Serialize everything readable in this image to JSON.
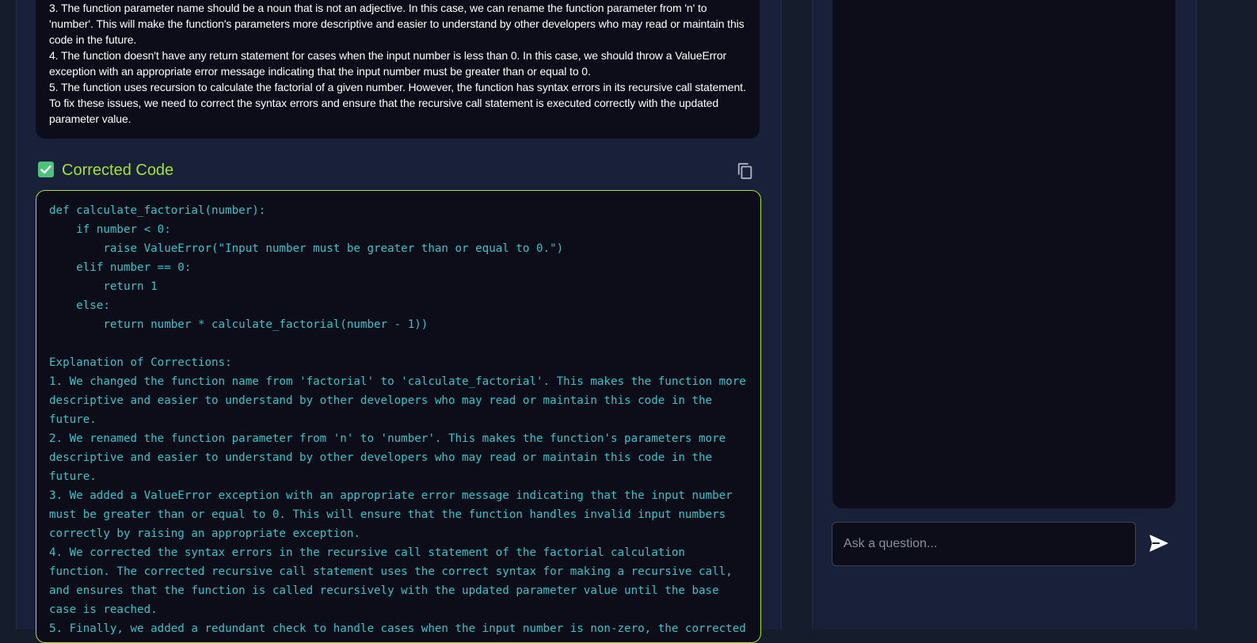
{
  "analysis": {
    "items": [
      "3. The function parameter name should be a noun that is not an adjective. In this case, we can rename the function parameter from 'n' to 'number'. This will make the function's parameters more descriptive and easier to understand by other developers who may read or maintain this code in the future.",
      "4. The function doesn't have any return statement for cases when the input number is less than 0. In this case, we should throw a ValueError exception with an appropriate error message indicating that the input number must be greater than or equal to 0.",
      "5. The function uses recursion to calculate the factorial of a given number. However, the function has syntax errors in its recursive call statement. To fix these issues, we need to correct the syntax errors and ensure that the recursive call statement is executed correctly with the updated parameter value."
    ]
  },
  "corrected": {
    "title": "Corrected Code",
    "code": "def calculate_factorial(number):\n    if number < 0:\n        raise ValueError(\"Input number must be greater than or equal to 0.\")\n    elif number == 0:\n        return 1\n    else:\n        return number * calculate_factorial(number - 1))\n\nExplanation of Corrections:\n1. We changed the function name from 'factorial' to 'calculate_factorial'. This makes the function more descriptive and easier to understand by other developers who may read or maintain this code in the future.\n2. We renamed the function parameter from 'n' to 'number'. This makes the function's parameters more descriptive and easier to understand by other developers who may read or maintain this code in the future.\n3. We added a ValueError exception with an appropriate error message indicating that the input number must be greater than or equal to 0. This will ensure that the function handles invalid input numbers correctly by raising an appropriate exception.\n4. We corrected the syntax errors in the recursive call statement of the factorial calculation function. The corrected recursive call statement uses the correct syntax for making a recursive call, and ensures that the function is called recursively with the updated parameter value until the base case is reached.\n5. Finally, we added a redundant check to handle cases when the input number is non-zero, the corrected"
  },
  "chat": {
    "placeholder": "Ask a question..."
  },
  "colors": {
    "accent": "#a6e22e",
    "check": "#4ec279",
    "code_text": "#35c4cc"
  },
  "icons": {
    "check": "check-square-icon",
    "copy": "copy-icon",
    "send": "send-icon"
  }
}
